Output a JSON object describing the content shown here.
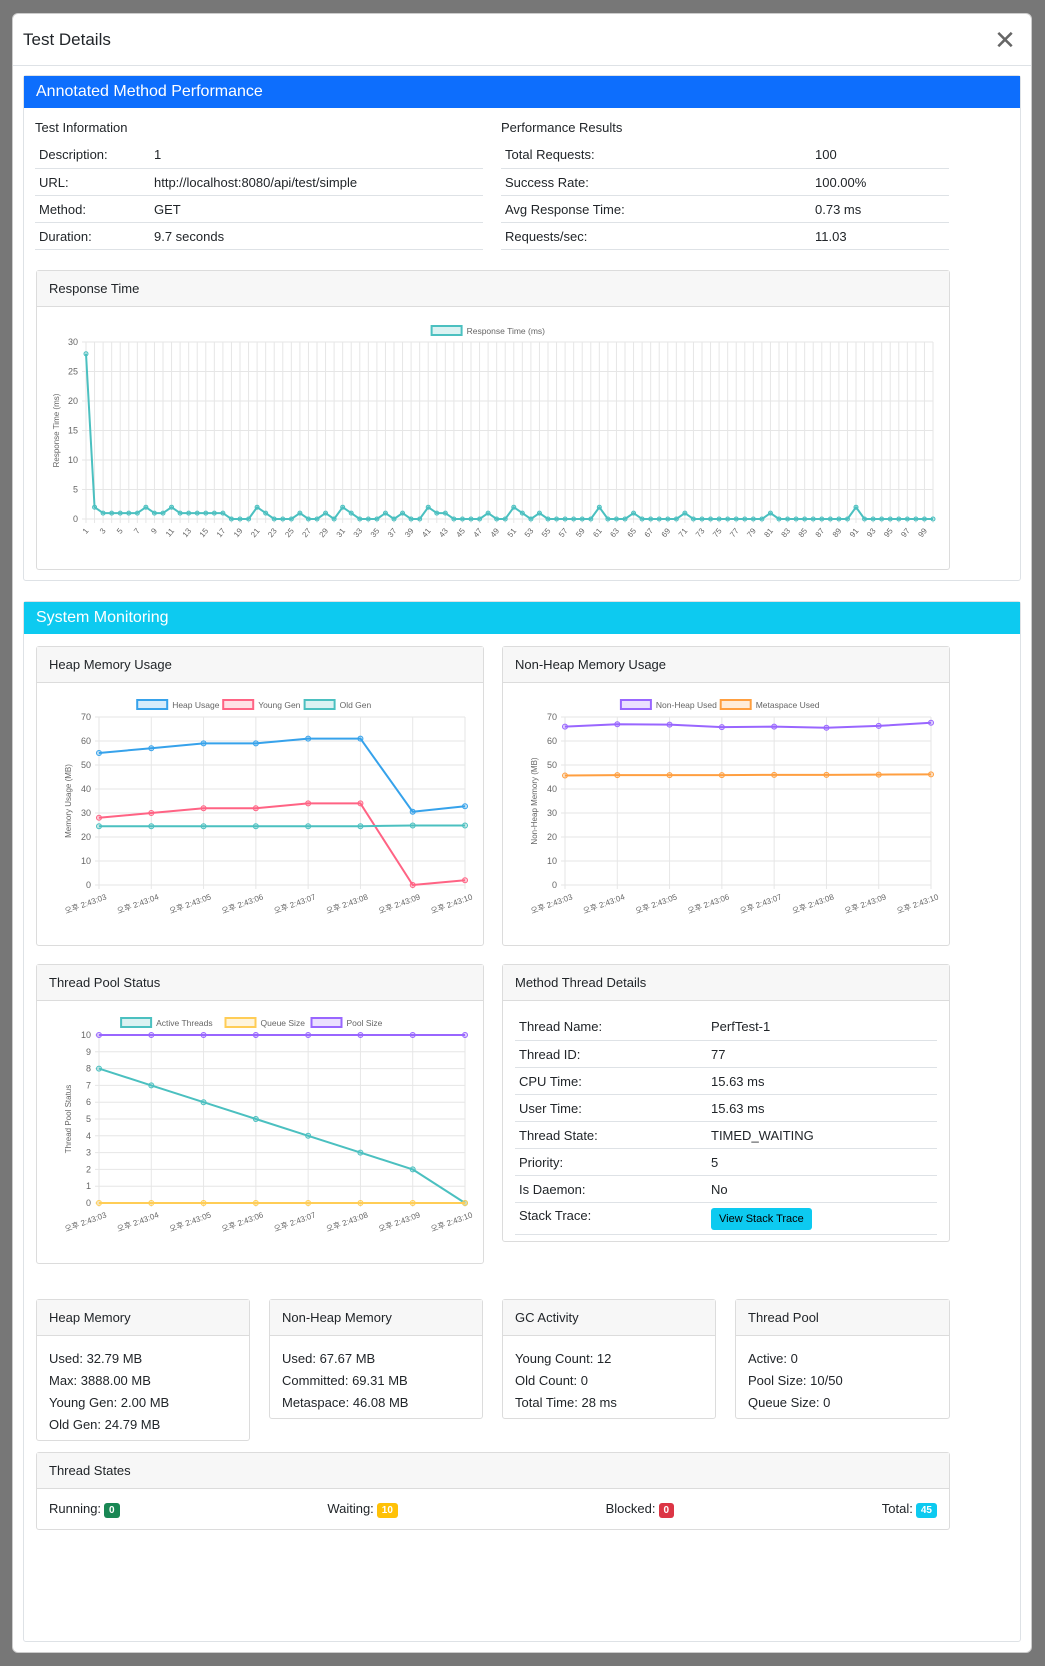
{
  "modal": {
    "title": "Test Details"
  },
  "annotated": {
    "header": "Annotated Method Performance",
    "test_info": {
      "heading": "Test Information",
      "rows": [
        {
          "label": "Description:",
          "value": "1"
        },
        {
          "label": "URL:",
          "value": "http://localhost:8080/api/test/simple"
        },
        {
          "label": "Method:",
          "value": "GET"
        },
        {
          "label": "Duration:",
          "value": "9.7 seconds"
        }
      ]
    },
    "perf": {
      "heading": "Performance Results",
      "rows": [
        {
          "label": "Total Requests:",
          "value": "100"
        },
        {
          "label": "Success Rate:",
          "value": "100.00%"
        },
        {
          "label": "Avg Response Time:",
          "value": "0.73 ms"
        },
        {
          "label": "Requests/sec:",
          "value": "11.03"
        }
      ]
    },
    "response_card_title": "Response Time"
  },
  "monitoring": {
    "header": "System Monitoring",
    "heap_card_title": "Heap Memory Usage",
    "nonheap_card_title": "Non-Heap Memory Usage",
    "thread_card_title": "Thread Pool Status",
    "method_thread": {
      "title": "Method Thread Details",
      "rows": [
        {
          "label": "Thread Name:",
          "value": "PerfTest-1"
        },
        {
          "label": "Thread ID:",
          "value": "77"
        },
        {
          "label": "CPU Time:",
          "value": "15.63 ms"
        },
        {
          "label": "User Time:",
          "value": "15.63 ms"
        },
        {
          "label": "Thread State:",
          "value": "TIMED_WAITING"
        },
        {
          "label": "Priority:",
          "value": "5"
        },
        {
          "label": "Is Daemon:",
          "value": "No"
        }
      ],
      "stack_label": "Stack Trace:",
      "stack_button": "View Stack Trace"
    },
    "stats": {
      "heap": {
        "title": "Heap Memory",
        "lines": [
          "Used: 32.79 MB",
          "Max: 3888.00 MB",
          "Young Gen: 2.00 MB",
          "Old Gen: 24.79 MB"
        ]
      },
      "nonheap": {
        "title": "Non-Heap Memory",
        "lines": [
          "Used: 67.67 MB",
          "Committed: 69.31 MB",
          "Metaspace: 46.08 MB"
        ]
      },
      "gc": {
        "title": "GC Activity",
        "lines": [
          "Young Count: 12",
          "Old Count: 0",
          "Total Time: 28 ms"
        ]
      },
      "pool": {
        "title": "Thread Pool",
        "lines": [
          "Active: 0",
          "Pool Size: 10/50",
          "Queue Size: 0"
        ]
      }
    },
    "thread_states": {
      "title": "Thread States",
      "items": [
        {
          "label": "Running:",
          "count": "0",
          "color": "#198754"
        },
        {
          "label": "Waiting:",
          "count": "10",
          "color": "#ffc107"
        },
        {
          "label": "Blocked:",
          "count": "0",
          "color": "#dc3545"
        },
        {
          "label": "Total:",
          "count": "45",
          "color": "#0dcaf0"
        }
      ]
    }
  },
  "chart_data": [
    {
      "id": "response",
      "type": "line",
      "title": "",
      "xlabel": "",
      "ylabel": "Response Time (ms)",
      "ylim": [
        0,
        30
      ],
      "yticks": [
        0,
        5,
        10,
        15,
        20,
        25,
        30
      ],
      "x": [
        1,
        2,
        3,
        4,
        5,
        6,
        7,
        8,
        9,
        10,
        11,
        12,
        13,
        14,
        15,
        16,
        17,
        18,
        19,
        20,
        21,
        22,
        23,
        24,
        25,
        26,
        27,
        28,
        29,
        30,
        31,
        32,
        33,
        34,
        35,
        36,
        37,
        38,
        39,
        40,
        41,
        42,
        43,
        44,
        45,
        46,
        47,
        48,
        49,
        50,
        51,
        52,
        53,
        54,
        55,
        56,
        57,
        58,
        59,
        60,
        61,
        62,
        63,
        64,
        65,
        66,
        67,
        68,
        69,
        70,
        71,
        72,
        73,
        74,
        75,
        76,
        77,
        78,
        79,
        80,
        81,
        82,
        83,
        84,
        85,
        86,
        87,
        88,
        89,
        90,
        91,
        92,
        93,
        94,
        95,
        96,
        97,
        98,
        99,
        100
      ],
      "xtick_labels": [
        "1",
        "3",
        "5",
        "7",
        "9",
        "11",
        "13",
        "15",
        "17",
        "19",
        "21",
        "23",
        "25",
        "27",
        "29",
        "31",
        "33",
        "35",
        "37",
        "39",
        "41",
        "43",
        "45",
        "47",
        "49",
        "51",
        "53",
        "55",
        "57",
        "59",
        "61",
        "63",
        "65",
        "67",
        "69",
        "71",
        "73",
        "75",
        "77",
        "79",
        "81",
        "83",
        "85",
        "87",
        "89",
        "91",
        "93",
        "95",
        "97",
        "99"
      ],
      "grid": true,
      "legend": "top",
      "series": [
        {
          "name": "Response Time (ms)",
          "color": "#4bc0c0",
          "values": [
            28,
            2,
            1,
            1,
            1,
            1,
            1,
            2,
            1,
            1,
            2,
            1,
            1,
            1,
            1,
            1,
            1,
            0,
            0,
            0,
            2,
            1,
            0,
            0,
            0,
            1,
            0,
            0,
            1,
            0,
            2,
            1,
            0,
            0,
            0,
            1,
            0,
            1,
            0,
            0,
            2,
            1,
            1,
            0,
            0,
            0,
            0,
            1,
            0,
            0,
            2,
            1,
            0,
            1,
            0,
            0,
            0,
            0,
            0,
            0,
            2,
            0,
            0,
            0,
            1,
            0,
            0,
            0,
            0,
            0,
            1,
            0,
            0,
            0,
            0,
            0,
            0,
            0,
            0,
            0,
            1,
            0,
            0,
            0,
            0,
            0,
            0,
            0,
            0,
            0,
            2,
            0,
            0,
            0,
            0,
            0,
            0,
            0,
            0,
            0
          ]
        }
      ]
    },
    {
      "id": "heap",
      "type": "line",
      "title": "",
      "xlabel": "",
      "ylabel": "Memory Usage (MB)",
      "ylim": [
        0,
        70
      ],
      "yticks": [
        0,
        10,
        20,
        30,
        40,
        50,
        60,
        70
      ],
      "categories": [
        "오후 2:43:03",
        "오후 2:43:04",
        "오후 2:43:05",
        "오후 2:43:06",
        "오후 2:43:07",
        "오후 2:43:08",
        "오후 2:43:09",
        "오후 2:43:10"
      ],
      "grid": true,
      "legend": "top",
      "series": [
        {
          "name": "Heap Usage",
          "color": "#36a2eb",
          "values": [
            55,
            57,
            59,
            59,
            61,
            61,
            30.5,
            32.8
          ]
        },
        {
          "name": "Young Gen",
          "color": "#ff6384",
          "values": [
            28,
            30,
            32,
            32,
            34,
            34,
            0,
            2
          ]
        },
        {
          "name": "Old Gen",
          "color": "#4bc0c0",
          "values": [
            24.5,
            24.5,
            24.5,
            24.5,
            24.5,
            24.5,
            24.8,
            24.8
          ]
        }
      ]
    },
    {
      "id": "nonheap",
      "type": "line",
      "title": "",
      "xlabel": "",
      "ylabel": "Non-Heap Memory (MB)",
      "ylim": [
        0,
        70
      ],
      "yticks": [
        0,
        10,
        20,
        30,
        40,
        50,
        60,
        70
      ],
      "categories": [
        "오후 2:43:03",
        "오후 2:43:04",
        "오후 2:43:05",
        "오후 2:43:06",
        "오후 2:43:07",
        "오후 2:43:08",
        "오후 2:43:09",
        "오후 2:43:10"
      ],
      "grid": true,
      "legend": "top",
      "series": [
        {
          "name": "Non-Heap Used",
          "color": "#9966ff",
          "values": [
            66,
            67,
            66.8,
            65.8,
            66,
            65.5,
            66.3,
            67.6
          ]
        },
        {
          "name": "Metaspace Used",
          "color": "#ff9f40",
          "values": [
            45.6,
            45.8,
            45.8,
            45.8,
            45.9,
            45.9,
            46,
            46.1
          ]
        }
      ]
    },
    {
      "id": "threads",
      "type": "line",
      "title": "",
      "xlabel": "",
      "ylabel": "Thread Pool Status",
      "ylim": [
        0,
        10
      ],
      "yticks": [
        0,
        1,
        2,
        3,
        4,
        5,
        6,
        7,
        8,
        9,
        10
      ],
      "categories": [
        "오후 2:43:03",
        "오후 2:43:04",
        "오후 2:43:05",
        "오후 2:43:06",
        "오후 2:43:07",
        "오후 2:43:08",
        "오후 2:43:09",
        "오후 2:43:10"
      ],
      "grid": true,
      "legend": "top",
      "series": [
        {
          "name": "Active Threads",
          "color": "#4bc0c0",
          "values": [
            8,
            7,
            6,
            5,
            4,
            3,
            2,
            0
          ]
        },
        {
          "name": "Queue Size",
          "color": "#ffcd56",
          "values": [
            0,
            0,
            0,
            0,
            0,
            0,
            0,
            0
          ]
        },
        {
          "name": "Pool Size",
          "color": "#9966ff",
          "values": [
            10,
            10,
            10,
            10,
            10,
            10,
            10,
            10
          ]
        }
      ]
    }
  ]
}
